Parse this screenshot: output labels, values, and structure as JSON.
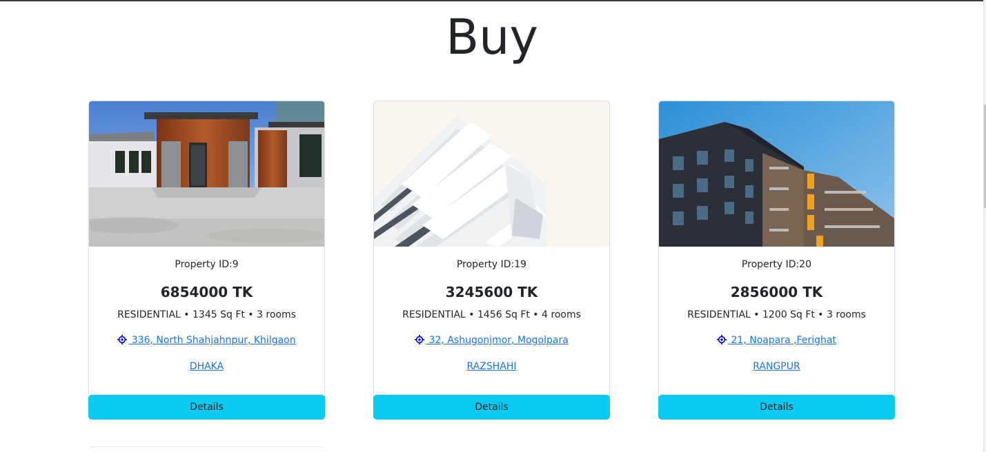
{
  "page": {
    "title": "Buy"
  },
  "cards": [
    {
      "property_id": "Property ID:9",
      "price": "6854000 TK",
      "meta": "RESIDENTIAL • 1345 Sq Ft • 3 rooms",
      "address": " 336, North Shahjahnpur, Khilgaon",
      "city": "DHAKA",
      "button": "Details",
      "image": "modern-house-photo"
    },
    {
      "property_id": "Property ID:19",
      "price": "3245600 TK",
      "meta": "RESIDENTIAL • 1456 Sq Ft • 4 rooms",
      "address": " 32, Ashugonjmor, Mogolpara",
      "city": "RAZSHAHI",
      "button": "Details",
      "image": "white-highrise-photo"
    },
    {
      "property_id": "Property ID:20",
      "price": "2856000 TK",
      "meta": "RESIDENTIAL • 1200 Sq Ft • 3 rooms",
      "address": " 21, Noapara ,Ferighat",
      "city": "RANGPUR",
      "button": "Details",
      "image": "apartment-block-photo"
    }
  ],
  "colors": {
    "accent": "#0dcaf0",
    "link": "#1a73e8",
    "text": "#212529"
  },
  "icons": {
    "location": "crosshair-location-icon"
  }
}
